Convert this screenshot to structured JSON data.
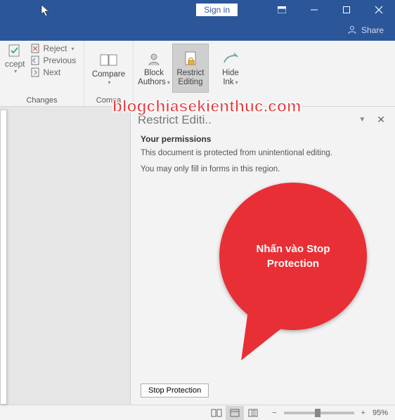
{
  "titlebar": {
    "signin": "Sign in"
  },
  "share": "Share",
  "ribbon": {
    "accept": "ccept",
    "reject": "Reject",
    "previous": "Previous",
    "next": "Next",
    "changes": "Changes",
    "compare": "Compare",
    "compare_group": "Compa",
    "block_authors_l1": "Block",
    "block_authors_l2": "Authors",
    "restrict_editing_l1": "Restrict",
    "restrict_editing_l2": "Editing",
    "hide_ink_l1": "Hide",
    "hide_ink_l2": "Ink"
  },
  "pane": {
    "title": "Restrict Editi..",
    "heading": "Your permissions",
    "p1": "This document is protected from unintentional editing.",
    "p2": "You may only fill in forms in this region.",
    "stop": "Stop Protection"
  },
  "watermark": "blogchiasekienthuc.com",
  "callout": "Nhấn vào Stop Protection",
  "statusbar": {
    "zoom": "95%"
  }
}
